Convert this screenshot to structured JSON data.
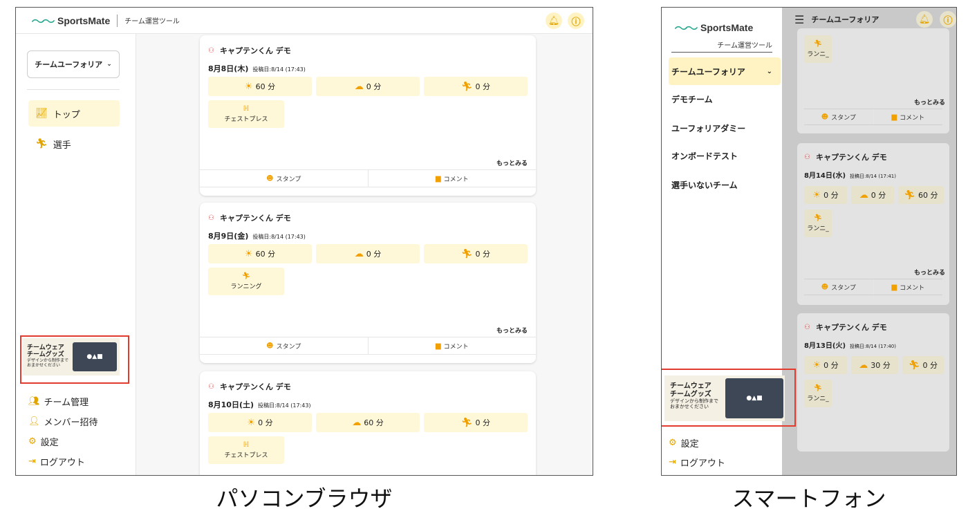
{
  "app": {
    "logo_text": "SportsMate",
    "subtitle": "チーム運営ツール"
  },
  "icons": {
    "bell": "bell-icon",
    "info": "info-icon",
    "menu": "hamburger-icon"
  },
  "colors": {
    "accent": "#e2a400",
    "highlight": "#fff8d8",
    "brand": "#2aa890",
    "red_box": "#e23b2e"
  },
  "desktop": {
    "team_select": "チームユーフォリア",
    "nav": [
      {
        "label": "トップ"
      },
      {
        "label": "選手"
      }
    ],
    "banner": {
      "line1": "チームウェア",
      "line2": "チームグッズ",
      "line3": "デザインから制作まで",
      "line4": "おまかせください"
    },
    "bottom_nav": [
      {
        "label": "チーム管理"
      },
      {
        "label": "メンバー招待"
      },
      {
        "label": "設定"
      },
      {
        "label": "ログアウト"
      }
    ],
    "cards": [
      {
        "author": "キャプテンくん デモ",
        "date": "8月8日(木)",
        "posted": "投稿日:8/14 (17:43)",
        "m1": "60 分",
        "m2": "0 分",
        "m3": "0 分",
        "exercise": "チェストプレス",
        "more": "もっとみる",
        "stamp": "スタンプ",
        "comment": "コメント"
      },
      {
        "author": "キャプテンくん デモ",
        "date": "8月9日(金)",
        "posted": "投稿日:8/14 (17:43)",
        "m1": "60 分",
        "m2": "0 分",
        "m3": "0 分",
        "exercise": "ランニング",
        "more": "もっとみる",
        "stamp": "スタンプ",
        "comment": "コメント"
      },
      {
        "author": "キャプテンくん デモ",
        "date": "8月10日(土)",
        "posted": "投稿日:8/14 (17:43)",
        "m1": "0 分",
        "m2": "60 分",
        "m3": "0 分",
        "exercise": "チェストプレス"
      }
    ]
  },
  "phone": {
    "header_team": "チームユーフォリア",
    "drawer_teams": [
      {
        "label": "チームユーフォリア"
      },
      {
        "label": "デモチーム"
      },
      {
        "label": "ユーフォリアダミー"
      },
      {
        "label": "オンボードテスト"
      },
      {
        "label": "選手いないチーム"
      }
    ],
    "bottom_nav": [
      {
        "label": "設定"
      },
      {
        "label": "ログアウト"
      }
    ],
    "cards": [
      {
        "exercise": "ランニ_",
        "more": "もっとみる",
        "stamp": "スタンプ",
        "comment": "コメント"
      },
      {
        "author": "キャプテンくん デモ",
        "date": "8月14日(水)",
        "posted": "投稿日:8/14 (17:41)",
        "m1": "0 分",
        "m2": "0 分",
        "m3": "60 分",
        "exercise": "ランニ_",
        "more": "もっとみる",
        "stamp": "スタンプ",
        "comment": "コメント"
      },
      {
        "author": "キャプテンくん デモ",
        "date": "8月13日(火)",
        "posted": "投稿日:8/14 (17:40)",
        "m1": "0 分",
        "m2": "30 分",
        "m3": "0 分",
        "exercise": "ランニ_"
      }
    ]
  },
  "captions": {
    "pc": "パソコンブラウザ",
    "phone": "スマートフォン"
  }
}
